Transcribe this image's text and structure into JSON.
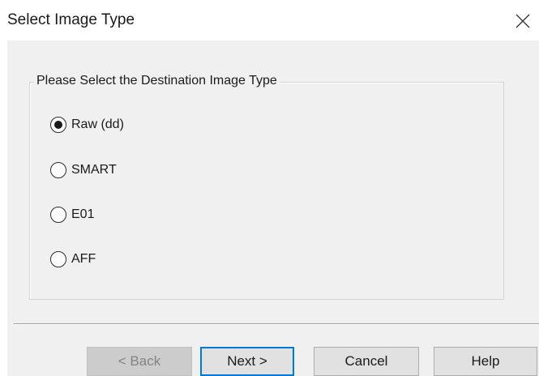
{
  "window": {
    "title": "Select Image Type",
    "close_icon": "close-icon"
  },
  "group": {
    "legend": "Please Select the Destination Image Type"
  },
  "options": [
    {
      "label": "Raw (dd)",
      "selected": true
    },
    {
      "label": "SMART",
      "selected": false
    },
    {
      "label": "E01",
      "selected": false
    },
    {
      "label": "AFF",
      "selected": false
    }
  ],
  "buttons": {
    "back": {
      "label": "< Back",
      "enabled": false
    },
    "next": {
      "label": "Next >",
      "default": true
    },
    "cancel": {
      "label": "Cancel"
    },
    "help": {
      "label": "Help"
    }
  },
  "colors": {
    "client_background": "#f0f0f0",
    "focus_border": "#0078d7",
    "button_face": "#e1e1e1",
    "disabled_text": "#838383"
  }
}
